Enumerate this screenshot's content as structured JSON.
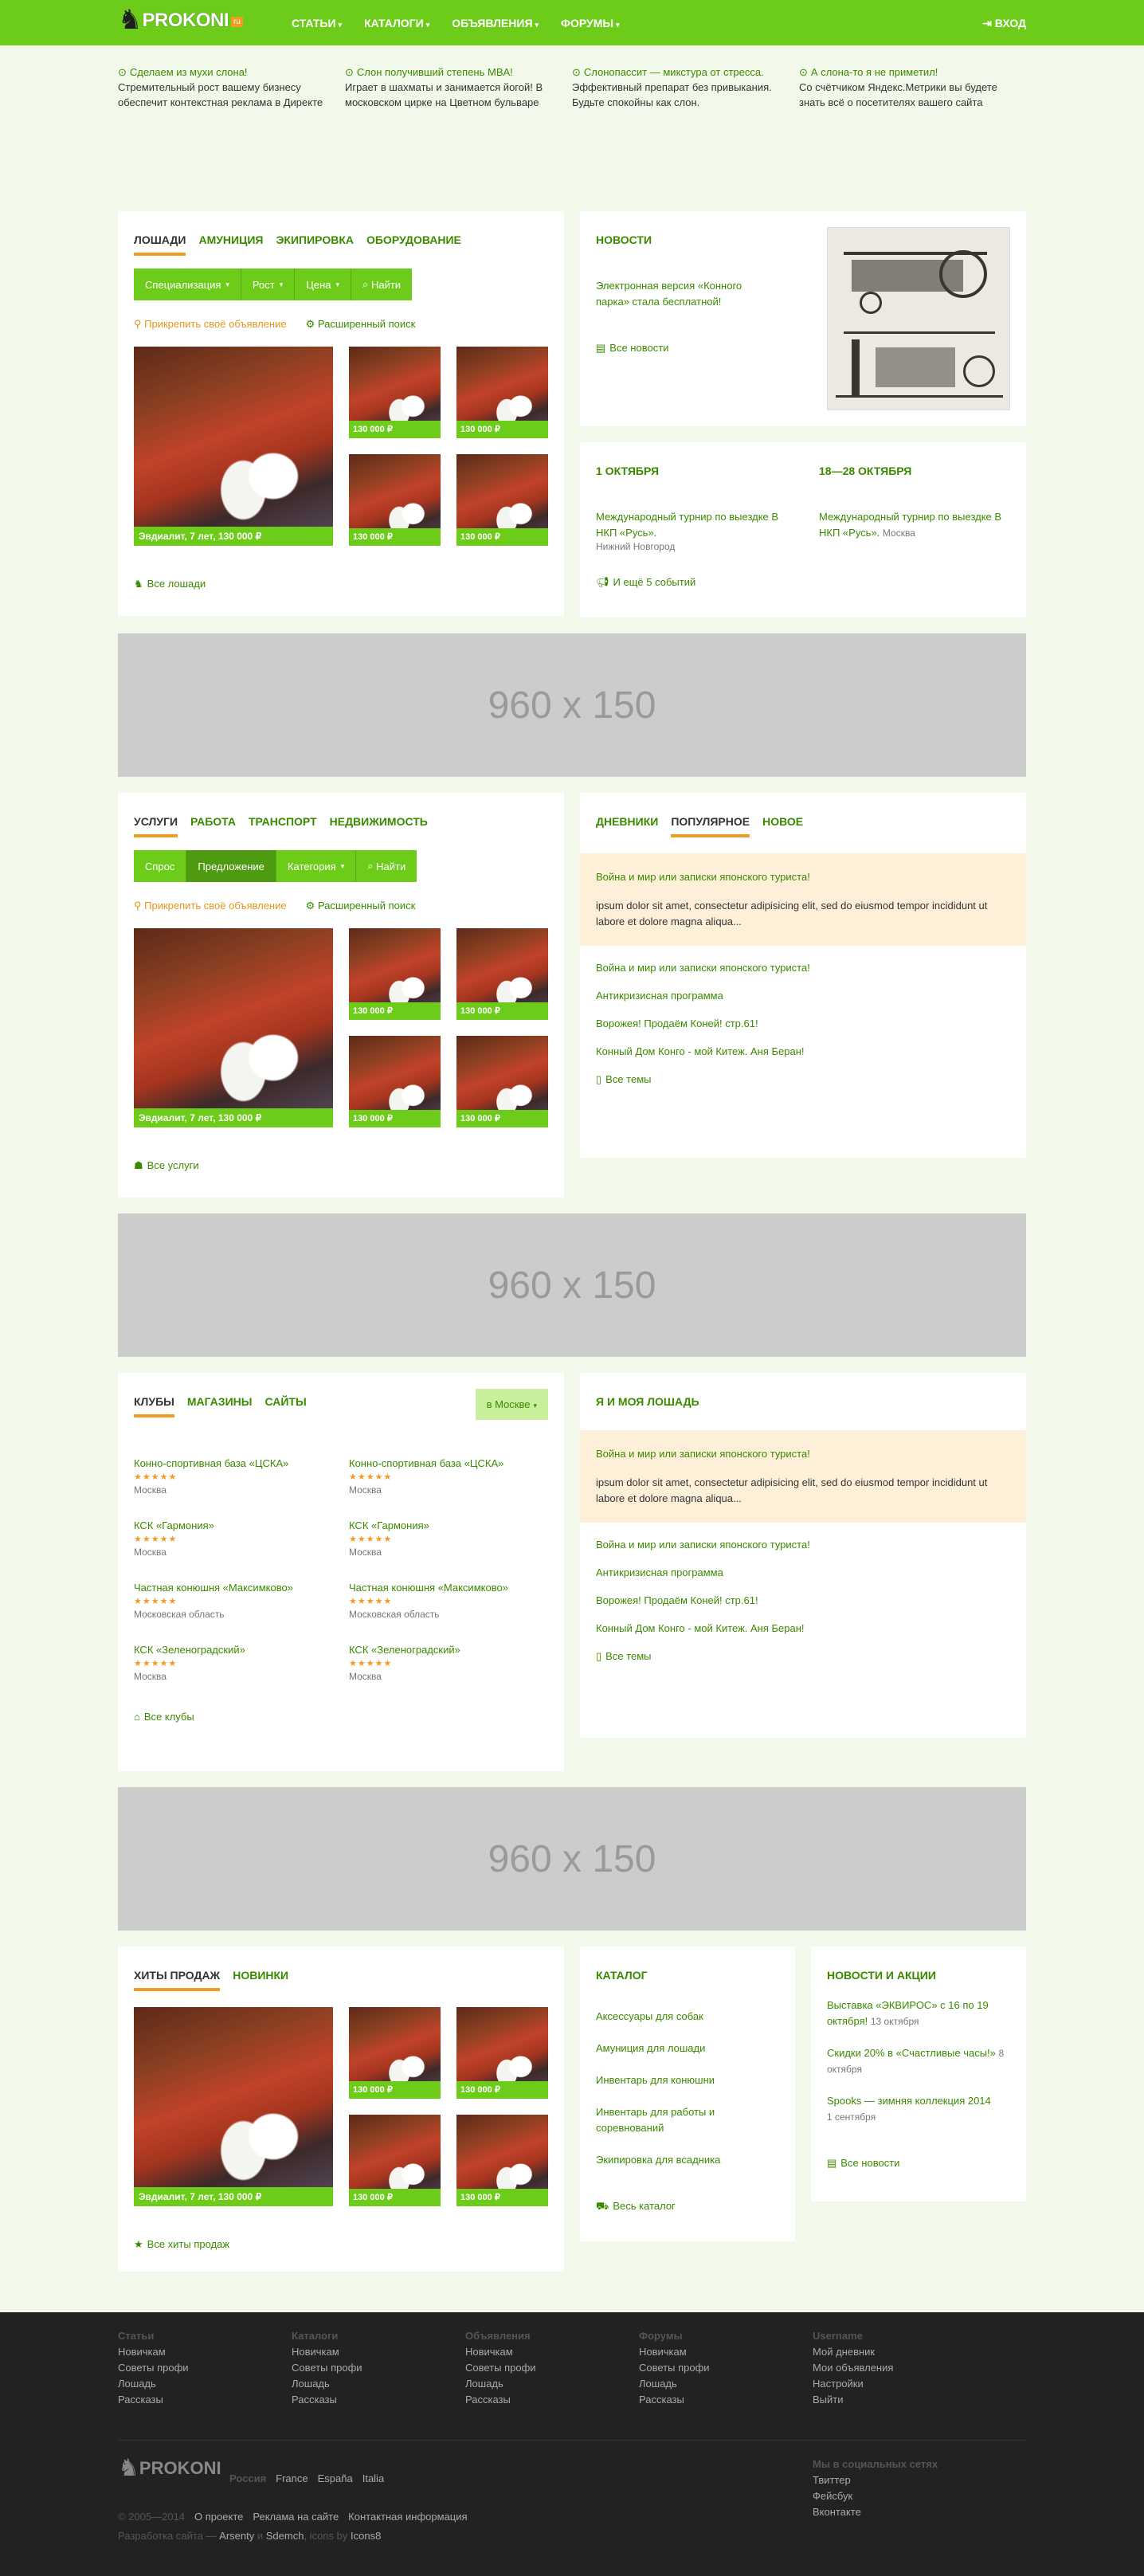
{
  "header": {
    "logo_text": "PROKONI",
    "logo_badge": "ru",
    "nav": [
      "СТАТЬИ",
      "КАТАЛОГИ",
      "ОБЪЯВЛЕНИЯ",
      "ФОРУМЫ"
    ],
    "login": "ВХОД"
  },
  "teasers": [
    {
      "link": "Сделаем из мухи слона!",
      "text": "Стремительный рост вашему бизнесу обеспечит контекстная реклама в Директе"
    },
    {
      "link": "Слон получивший степень MBA!",
      "text": "Играет в шахматы и занимается йогой! В московском цирке на Цветном бульваре"
    },
    {
      "link": "Слонопассит — микстура от стресса.",
      "text": "Эффективный препарат без привыкания. Будьте спокойны как слон."
    },
    {
      "link": "А слона-то я не приметил!",
      "text": "Со счётчиком Яндекс.Метрики вы будете знать всё о посетителях вашего сайта"
    }
  ],
  "horses": {
    "tabs": [
      "ЛОШАДИ",
      "АМУНИЦИЯ",
      "ЭКИПИРОВКА",
      "ОБОРУДОВАНИЕ"
    ],
    "filters": [
      "Специализация",
      "Рост",
      "Цена"
    ],
    "search": "Найти",
    "pin": "Прикрепить своё объявление",
    "advanced": "Расширенный поиск",
    "big_caption": "Эвдиалит, 7 лет, 130 000 ₽",
    "small_captions": [
      "130 000 ₽",
      "130 000 ₽",
      "130 000 ₽",
      "130 000 ₽"
    ],
    "all": "Все лошади"
  },
  "news": {
    "title": "НОВОСТИ",
    "text": "Электронная версия «Конного парка» стала бесплатной!",
    "all": "Все новости"
  },
  "events": {
    "items": [
      {
        "date": "1 ОКТЯБРЯ",
        "title": "Международный турнир по выездке В НКП «Русь».",
        "city": "Нижний Новгород"
      },
      {
        "date": "18—28 ОКТЯБРЯ",
        "title": "Международный турнир по выездке В НКП «Русь».",
        "city": "Москва"
      }
    ],
    "more": "И ещё 5 событий"
  },
  "banner": "960 x 150",
  "services": {
    "tabs": [
      "УСЛУГИ",
      "РАБОТА",
      "ТРАНСПОРТ",
      "НЕДВИЖИМОСТЬ"
    ],
    "filters": [
      "Спрос",
      "Предложение",
      "Категория"
    ],
    "search": "Найти",
    "pin": "Прикрепить своё объявление",
    "advanced": "Расширенный поиск",
    "big_caption": "Эвдиалит, 7 лет, 130 000 ₽",
    "small_captions": [
      "130 000 ₽",
      "130 000 ₽",
      "130 000 ₽",
      "130 000 ₽"
    ],
    "all": "Все услуги"
  },
  "forum1": {
    "tabs": [
      "ДНЕВНИКИ",
      "ПОПУЛЯРНОЕ",
      "НОВОЕ"
    ],
    "hl_title": "Война и мир или записки японского туриста!",
    "hl_text": "ipsum dolor sit amet, consectetur adipisicing elit, sed do eiusmod tempor incididunt ut labore et dolore magna aliqua...",
    "items": [
      "Война и мир или записки японского туриста!",
      "Антикризисная программа",
      "Ворожея! Продаём Коней! стр.61!",
      "Конный Дом Конго - мой Китеж. Аня Беран!"
    ],
    "all": "Все темы"
  },
  "clubs": {
    "tabs": [
      "КЛУБЫ",
      "МАГАЗИНЫ",
      "САЙТЫ"
    ],
    "location": "в Москве",
    "items": [
      {
        "name": "Конно-спортивная база «ЦСКА»",
        "stars": "★★★★★",
        "city": "Москва"
      },
      {
        "name": "Конно-спортивная база «ЦСКА»",
        "stars": "★★★★★",
        "city": "Москва"
      },
      {
        "name": "КСК «Гармония»",
        "stars": "★★★★★",
        "city": "Москва"
      },
      {
        "name": "КСК «Гармония»",
        "stars": "★★★★★",
        "city": "Москва"
      },
      {
        "name": "Частная конюшня «Максимково»",
        "stars": "★★★★★",
        "city": "Московская область"
      },
      {
        "name": "Частная конюшня «Максимково»",
        "stars": "★★★★★",
        "city": "Московская область"
      },
      {
        "name": "КСК «Зеленоградский»",
        "stars": "★★★★★",
        "city": "Москва"
      },
      {
        "name": "КСК «Зеленоградский»",
        "stars": "★★★★★",
        "city": "Москва"
      }
    ],
    "all": "Все клубы"
  },
  "forum2": {
    "title": "Я И МОЯ ЛОШАДЬ",
    "hl_title": "Война и мир или записки японского туриста!",
    "hl_text": "ipsum dolor sit amet, consectetur adipisicing elit, sed do eiusmod tempor incididunt ut labore et dolore magna aliqua...",
    "items": [
      "Война и мир или записки японского туриста!",
      "Антикризисная программа",
      "Ворожея! Продаём Коней! стр.61!",
      "Конный Дом Конго - мой Китеж. Аня Беран!"
    ],
    "all": "Все темы"
  },
  "hits": {
    "tabs": [
      "ХИТЫ ПРОДАЖ",
      "НОВИНКИ"
    ],
    "big_caption": "Эвдиалит, 7 лет, 130 000 ₽",
    "small_captions": [
      "130 000 ₽",
      "130 000 ₽",
      "130 000 ₽",
      "130 000 ₽"
    ],
    "all": "Все хиты продаж"
  },
  "catalog": {
    "title": "КАТАЛОГ",
    "items": [
      "Аксессуары для собак",
      "Амуниция для лошади",
      "Инвентарь для конюшни",
      "Инвентарь для работы и соревнований",
      "Экипировка для всадника"
    ],
    "all": "Весь каталог"
  },
  "promo": {
    "title": "НОВОСТИ И АКЦИИ",
    "items": [
      {
        "text": "Выставка «ЭКВИРОС» с 16 по 19 октября!",
        "date": "13 октября"
      },
      {
        "text": "Скидки 20% в «Счастливые часы!»",
        "date": "8 октября"
      },
      {
        "text": "Spooks — зимняя коллекция 2014",
        "date": "1 сентября"
      }
    ],
    "all": "Все новости"
  },
  "footer": {
    "cols": [
      {
        "title": "Статьи",
        "links": [
          "Новичкам",
          "Советы профи",
          "Лошадь",
          "Рассказы"
        ]
      },
      {
        "title": "Каталоги",
        "links": [
          "Новичкам",
          "Советы профи",
          "Лошадь",
          "Рассказы"
        ]
      },
      {
        "title": "Объявления",
        "links": [
          "Новичкам",
          "Советы профи",
          "Лошадь",
          "Рассказы"
        ]
      },
      {
        "title": "Форумы",
        "links": [
          "Новичкам",
          "Советы профи",
          "Лошадь",
          "Рассказы"
        ]
      },
      {
        "title": "Username",
        "links": [
          "Мой дневник",
          "Мои объявления",
          "Настройки",
          "Выйти"
        ]
      }
    ],
    "logo_text": "PROKONI",
    "langs": [
      "Россия",
      "France",
      "España",
      "Italia"
    ],
    "social_title": "Мы в социальных сетях",
    "social": [
      "Твиттер",
      "Фейсбук",
      "Вконтакте"
    ],
    "copyright": "© 2005—2014",
    "links": [
      "О проекте",
      "Реклама на сайте",
      "Контактная информация"
    ],
    "dev_prefix": "Разработка сайта —",
    "dev1": "Arsenty",
    "dev_and": "и",
    "dev2": "Sdemch",
    "icons_prefix": ", icons by",
    "icons": "Icons8"
  },
  "colors": {
    "brand": "#6dcc1a",
    "accent": "#f29c1f",
    "link": "#3a8a00",
    "footer": "#222222"
  }
}
